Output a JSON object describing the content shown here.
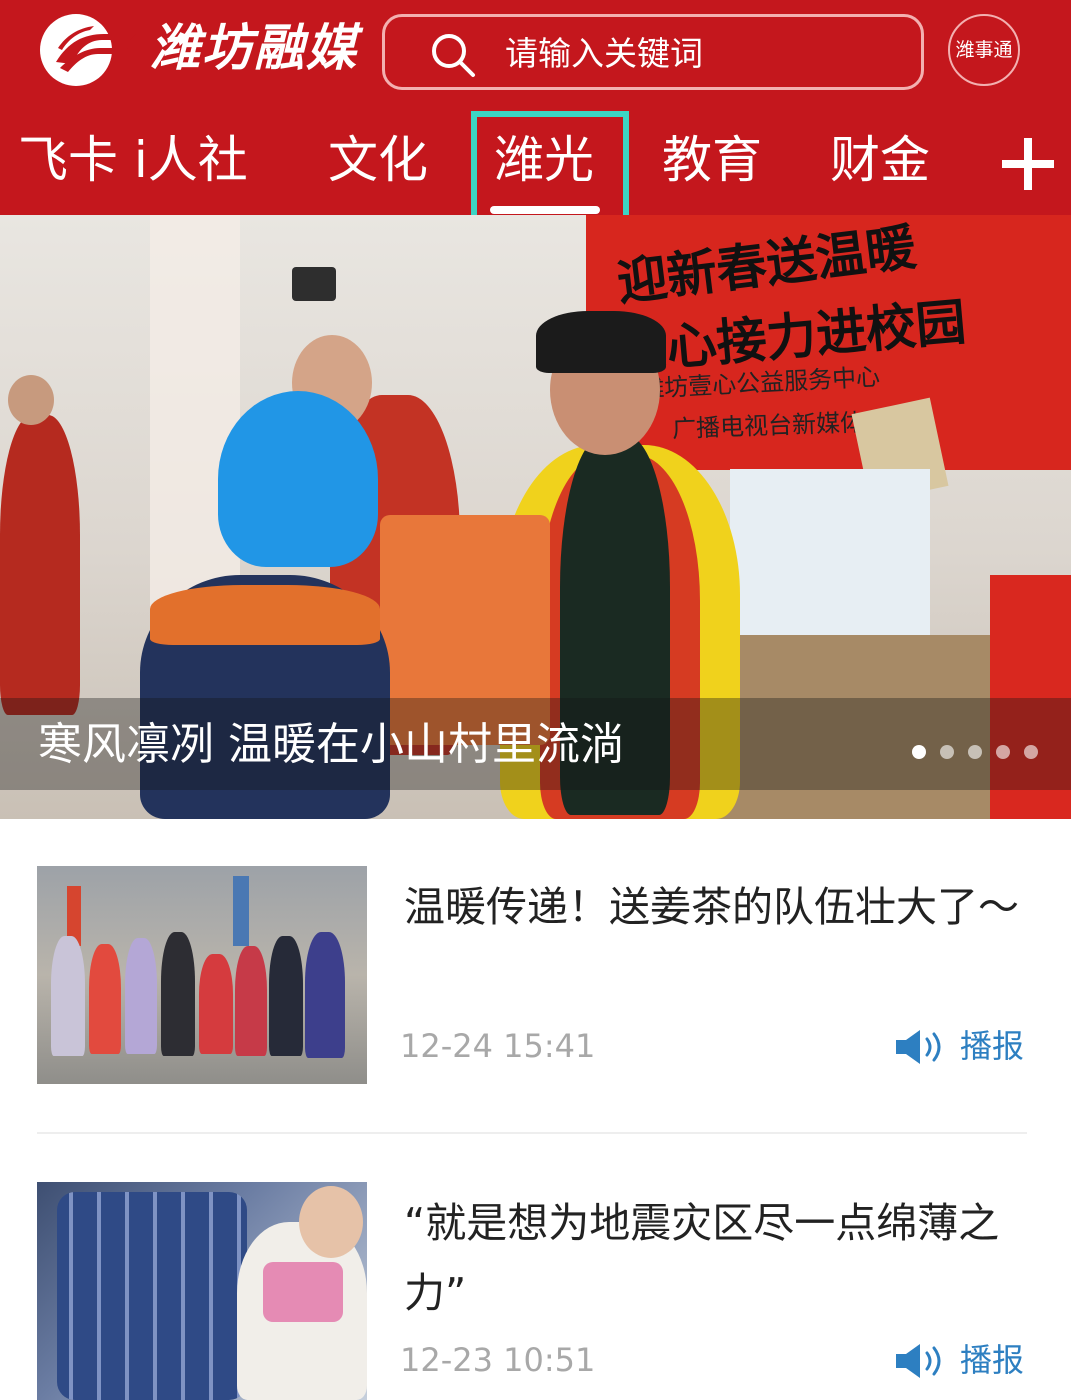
{
  "header": {
    "brand_name": "潍坊融媒",
    "search_placeholder": "请输入关键词",
    "service_button_label": "潍事通"
  },
  "tabs": [
    {
      "label": "飞卡 i人社"
    },
    {
      "label": "人社"
    },
    {
      "label": "文化"
    },
    {
      "label": "潍光",
      "active": true
    },
    {
      "label": "教育"
    },
    {
      "label": "财金"
    }
  ],
  "banner": {
    "caption": "寒风凛冽 温暖在小山村里流淌",
    "scene_text_1": "迎新春送温暖",
    "scene_text_2": "爱心接力进校园",
    "scene_text_3": "潍坊壹心公益服务中心",
    "scene_text_4": "广播电视台新媒体中心",
    "slide_count": 5,
    "active_slide": 1
  },
  "news": [
    {
      "title": "温暖传递！送姜茶的队伍壮大了～",
      "time": "12-24 15:41",
      "broadcast_label": "播报"
    },
    {
      "title": "“就是想为地震灾区尽一点绵薄之力”",
      "time": "12-23 10:51",
      "broadcast_label": "播报"
    }
  ],
  "colors": {
    "brand_red": "#c4171d",
    "active_tab_outline": "#3cd4c4",
    "broadcast_blue": "#2d7fc1",
    "timestamp_gray": "#a8a8a8"
  },
  "icons": {
    "logo": "weifang-rongmei-logo-icon",
    "search": "search-icon",
    "more_tabs": "plus-icon",
    "broadcast": "speaker-icon"
  }
}
